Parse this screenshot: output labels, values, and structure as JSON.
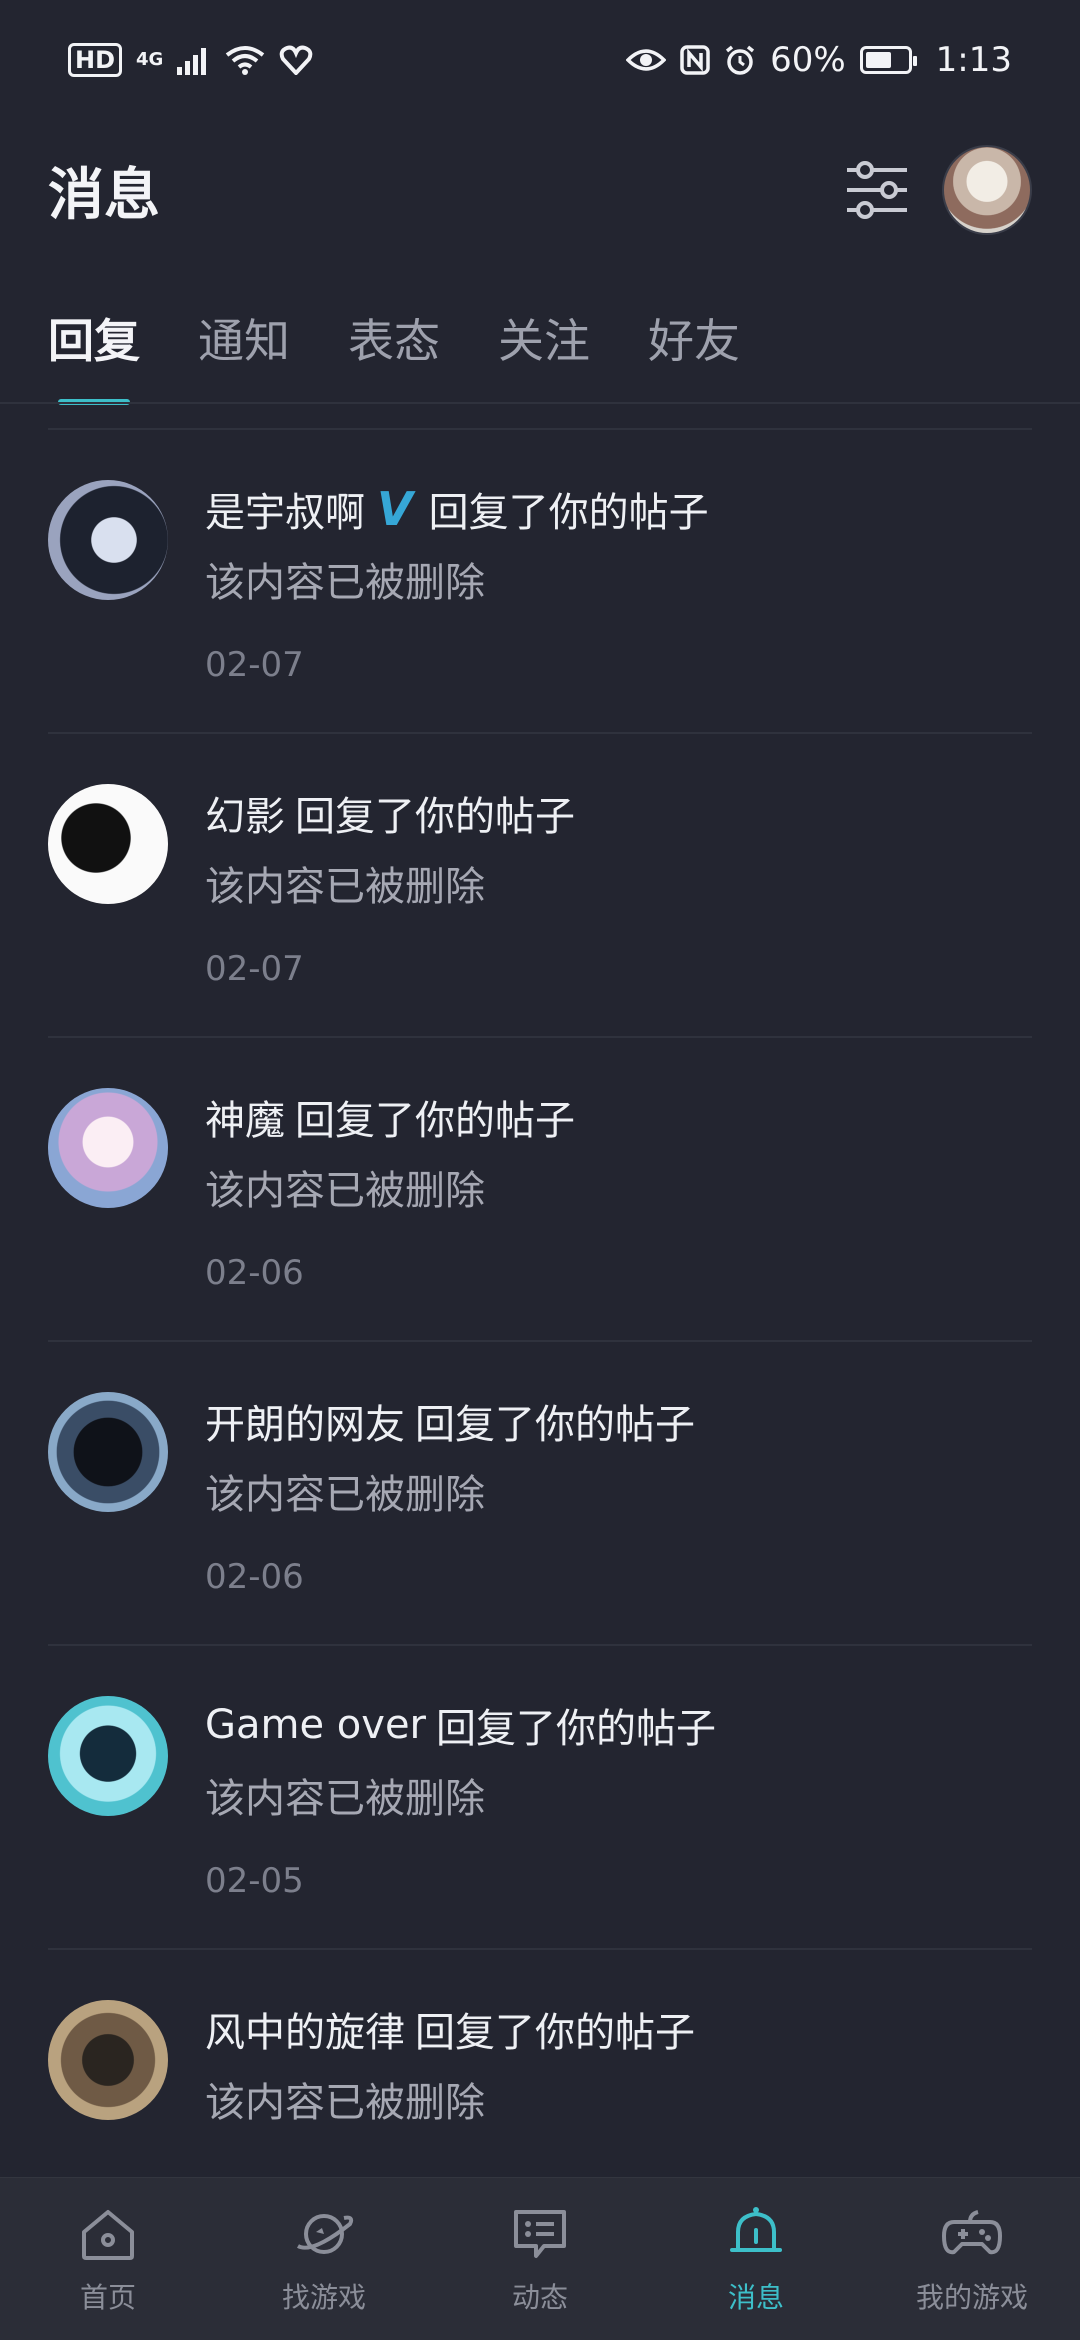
{
  "status_bar": {
    "hd": "HD",
    "network": "4G",
    "battery_percent": "60%",
    "time": "1:13"
  },
  "header": {
    "title": "消息"
  },
  "tabs": [
    {
      "label": "回复",
      "active": true
    },
    {
      "label": "通知",
      "active": false
    },
    {
      "label": "表态",
      "active": false
    },
    {
      "label": "关注",
      "active": false
    },
    {
      "label": "好友",
      "active": false
    }
  ],
  "messages": [
    {
      "user": "是宇叔啊",
      "badge": "V",
      "action": "回复了你的帖子",
      "content": "该内容已被删除",
      "date": "02-07"
    },
    {
      "user": "幻影",
      "action": "回复了你的帖子",
      "content": "该内容已被删除",
      "date": "02-07"
    },
    {
      "user": "神魔",
      "action": "回复了你的帖子",
      "content": "该内容已被删除",
      "date": "02-06"
    },
    {
      "user": "开朗的网友",
      "action": "回复了你的帖子",
      "content": "该内容已被删除",
      "date": "02-06"
    },
    {
      "user": "Game over",
      "action": "回复了你的帖子",
      "content": "该内容已被删除",
      "date": "02-05"
    },
    {
      "user": "风中的旋律",
      "action": "回复了你的帖子",
      "content": "该内容已被删除",
      "date": ""
    }
  ],
  "bottom_nav": [
    {
      "label": "首页",
      "icon": "home-icon",
      "active": false
    },
    {
      "label": "找游戏",
      "icon": "planet-icon",
      "active": false
    },
    {
      "label": "动态",
      "icon": "chat-icon",
      "active": false
    },
    {
      "label": "消息",
      "icon": "bell-icon",
      "active": true
    },
    {
      "label": "我的游戏",
      "icon": "gamepad-icon",
      "active": false
    }
  ],
  "colors": {
    "accent": "#3dbfc9",
    "background": "#232530"
  }
}
